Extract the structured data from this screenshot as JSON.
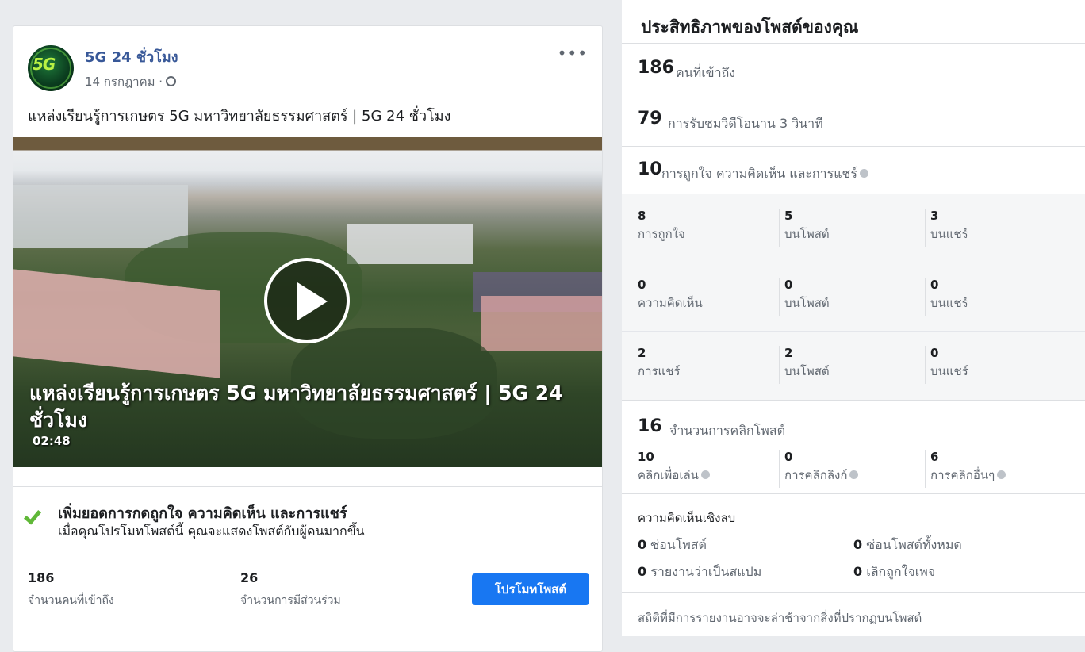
{
  "post": {
    "page_name": "5G 24 ชั่วโมง",
    "avatar_logo": "5G",
    "date": "14 กรกฎาคม ·",
    "more_label": "•••",
    "text": "แหล่งเรียนรู้การเกษตร 5G มหาวิทยาลัยธรรมศาสตร์ | 5G 24 ชั่วโมง",
    "video": {
      "title": "แหล่งเรียนรู้การเกษตร 5G มหาวิทยาลัยธรรมศาสตร์ | 5G 24 ชั่วโมง",
      "duration": "02:48"
    },
    "boost": {
      "title": "เพิ่มยอดการกดถูกใจ ความคิดเห็น และการแชร์",
      "subtitle": "เมื่อคุณโปรโมทโพสต์นี้ คุณจะแสดงโพสต์กับผู้คนมากขึ้น"
    },
    "stats": {
      "reach_value": "186",
      "reach_label": "จำนวนคนที่เข้าถึง",
      "engagement_value": "26",
      "engagement_label": "จำนวนการมีส่วนร่วม"
    },
    "promote_label": "โปรโมทโพสต์",
    "colors": {
      "link": "#385898",
      "promote_button": "#1877f2",
      "check": "#60b838"
    }
  },
  "insights": {
    "title": "ประสิทธิภาพของโพสต์ของคุณ",
    "reach": {
      "value": "186",
      "label": "คนที่เข้าถึง"
    },
    "views": {
      "value": "79",
      "label": "การรับชมวิดีโอนาน 3 วินาที"
    },
    "engagement": {
      "value": "10",
      "label": "การถูกใจ ความคิดเห็น และการแชร์"
    },
    "breakdown": [
      {
        "total": "8",
        "total_label": "การถูกใจ",
        "on_post": "5",
        "on_post_label": "บนโพสต์",
        "on_share": "3",
        "on_share_label": "บนแชร์"
      },
      {
        "total": "0",
        "total_label": "ความคิดเห็น",
        "on_post": "0",
        "on_post_label": "บนโพสต์",
        "on_share": "0",
        "on_share_label": "บนแชร์"
      },
      {
        "total": "2",
        "total_label": "การแชร์",
        "on_post": "2",
        "on_post_label": "บนโพสต์",
        "on_share": "0",
        "on_share_label": "บนแชร์"
      }
    ],
    "clicks": {
      "value": "16",
      "label": "จำนวนการคลิกโพสต์",
      "items": [
        {
          "value": "10",
          "label": "คลิกเพื่อเล่น"
        },
        {
          "value": "0",
          "label": "การคลิกลิงก์"
        },
        {
          "value": "6",
          "label": "การคลิกอื่นๆ"
        }
      ]
    },
    "negative": {
      "title": "ความคิดเห็นเชิงลบ",
      "hide_post": {
        "value": "0",
        "label": "ซ่อนโพสต์"
      },
      "hide_all": {
        "value": "0",
        "label": "ซ่อนโพสต์ทั้งหมด"
      },
      "report_spam": {
        "value": "0",
        "label": "รายงานว่าเป็นสแปม"
      },
      "unlike_page": {
        "value": "0",
        "label": "เลิกถูกใจเพจ"
      }
    },
    "footer": "สถิติที่มีการรายงานอาจจะล่าช้าจากสิ่งที่ปรากฏบนโพสต์"
  }
}
